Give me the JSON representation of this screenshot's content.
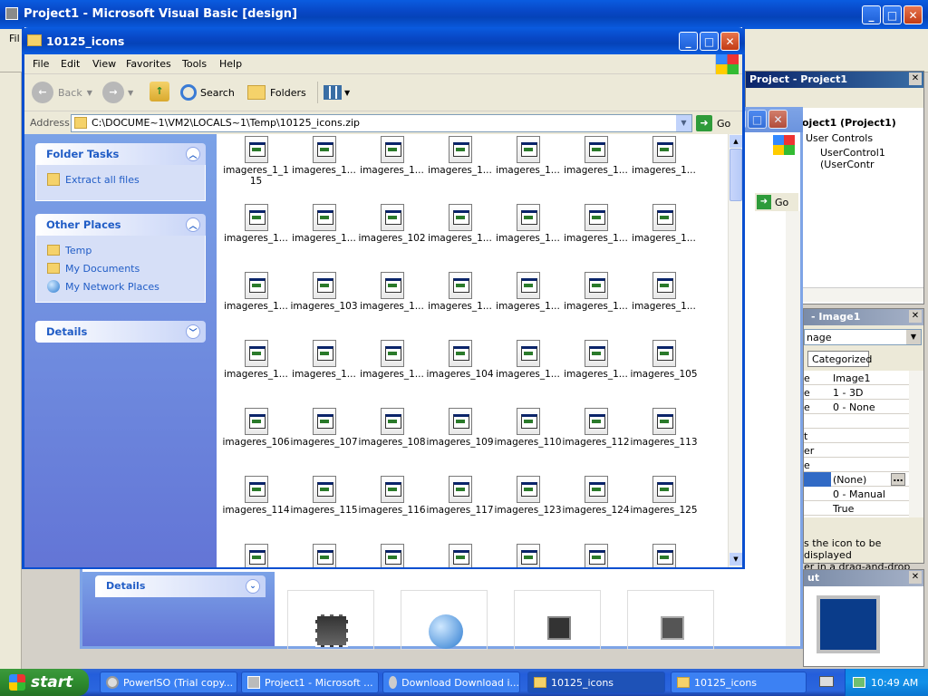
{
  "vb": {
    "title": "Project1 - Microsoft Visual Basic [design]",
    "project_title": "Project - Project1",
    "project_root": "oject1 (Project1)",
    "user_controls": "User Controls",
    "user_control_item": "UserControl1 (UserContr",
    "go_label": "Go",
    "props_title": "- Image1",
    "props_combo": "nage",
    "categorized_tab": "Categorized",
    "props": [
      {
        "key": "e",
        "val": "Image1"
      },
      {
        "key": "e",
        "val": "1 - 3D"
      },
      {
        "key": "e",
        "val": "0 - None"
      },
      {
        "key": "",
        "val": ""
      },
      {
        "key": "t",
        "val": ""
      },
      {
        "key": "er",
        "val": ""
      },
      {
        "key": "e",
        "val": ""
      },
      {
        "key": "",
        "val": "(None)"
      },
      {
        "key": "",
        "val": "0 - Manual"
      },
      {
        "key": "",
        "val": "True"
      }
    ],
    "desc_line1": "s the icon to be displayed",
    "desc_line2": "er in a drag-and-drop",
    "layout_title": "ut"
  },
  "bg_window": {
    "details_label": "Details"
  },
  "explorer": {
    "title": "10125_icons",
    "menu": [
      "File",
      "Edit",
      "View",
      "Favorites",
      "Tools",
      "Help"
    ],
    "toolbar": {
      "back": "Back",
      "search": "Search",
      "folders": "Folders"
    },
    "address_label": "Address",
    "address_value": "C:\\DOCUME~1\\VM2\\LOCALS~1\\Temp\\10125_icons.zip",
    "go_label": "Go",
    "folder_tasks": {
      "title": "Folder Tasks",
      "items": [
        "Extract all files"
      ]
    },
    "other_places": {
      "title": "Other Places",
      "items": [
        "Temp",
        "My Documents",
        "My Network Places"
      ]
    },
    "details": {
      "title": "Details"
    },
    "files": [
      "imageres_1_115",
      "imageres_1...",
      "imageres_1...",
      "imageres_1...",
      "imageres_1...",
      "imageres_1...",
      "imageres_1...",
      "imageres_1...",
      "imageres_1...",
      "imageres_102",
      "imageres_1...",
      "imageres_1...",
      "imageres_1...",
      "imageres_1...",
      "imageres_1...",
      "imageres_103",
      "imageres_1...",
      "imageres_1...",
      "imageres_1...",
      "imageres_1...",
      "imageres_1...",
      "imageres_1...",
      "imageres_1...",
      "imageres_1...",
      "imageres_104",
      "imageres_1...",
      "imageres_1...",
      "imageres_105",
      "imageres_106",
      "imageres_107",
      "imageres_108",
      "imageres_109",
      "imageres_110",
      "imageres_112",
      "imageres_113",
      "imageres_114",
      "imageres_115",
      "imageres_116",
      "imageres_117",
      "imageres_123",
      "imageres_124",
      "imageres_125",
      "",
      "",
      "",
      "",
      "",
      "",
      ""
    ]
  },
  "taskbar": {
    "start_label": "start",
    "buttons": [
      {
        "label": "PowerISO (Trial copy...",
        "icon": "poweriso-icon"
      },
      {
        "label": "Project1 - Microsoft ...",
        "icon": "vb-icon"
      },
      {
        "label": "Download Download i...",
        "icon": "download-icon"
      },
      {
        "label": "10125_icons",
        "icon": "folder-icon"
      },
      {
        "label": "10125_icons",
        "icon": "folder-icon"
      }
    ],
    "clock": "10:49 AM"
  }
}
